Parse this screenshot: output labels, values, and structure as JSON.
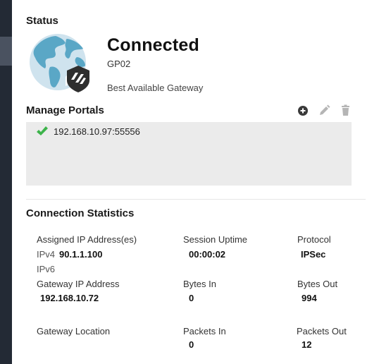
{
  "status": {
    "heading": "Status",
    "state": "Connected",
    "gateway_name": "GP02",
    "gateway_mode": "Best Available Gateway"
  },
  "portals": {
    "heading": "Manage Portals",
    "actions": [
      "add-icon",
      "edit-icon",
      "delete-icon"
    ],
    "items": [
      {
        "address": "192.168.10.97:55556",
        "connected": true
      }
    ]
  },
  "stats": {
    "heading": "Connection Statistics",
    "assigned_ip_label": "Assigned IP Address(es)",
    "ipv4_label": "IPv4",
    "ipv4_value": "90.1.1.100",
    "ipv6_label": "IPv6",
    "session_uptime_label": "Session Uptime",
    "session_uptime_value": "00:00:02",
    "protocol_label": "Protocol",
    "protocol_value": "IPSec",
    "gateway_ip_label": "Gateway IP Address",
    "gateway_ip_value": "192.168.10.72",
    "bytes_in_label": "Bytes In",
    "bytes_in_value": "0",
    "bytes_out_label": "Bytes Out",
    "bytes_out_value": "994",
    "gateway_location_label": "Gateway Location",
    "packets_in_label": "Packets In",
    "packets_in_value": "0",
    "packets_out_label": "Packets Out",
    "packets_out_value": "12"
  },
  "colors": {
    "globe_water": "#cfe3ee",
    "globe_land": "#5aa7c6",
    "check_green": "#3cb34a",
    "sidebar": "#232a35"
  }
}
